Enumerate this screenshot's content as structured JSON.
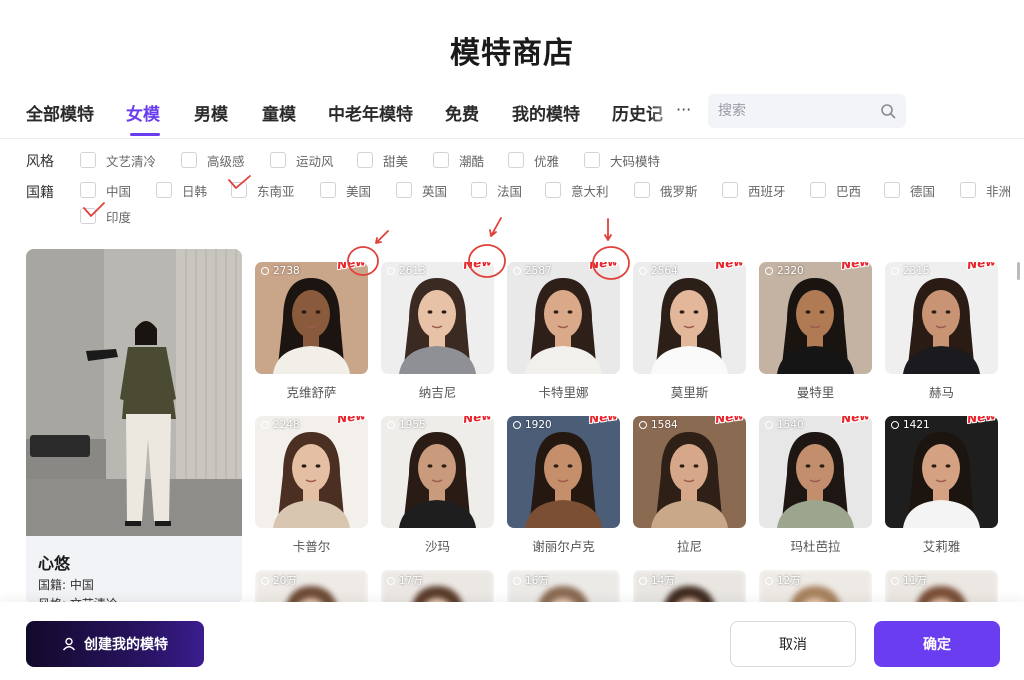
{
  "title": "模特商店",
  "tabs": [
    {
      "label": "全部模特"
    },
    {
      "label": "女模"
    },
    {
      "label": "男模"
    },
    {
      "label": "童模"
    },
    {
      "label": "中老年模特"
    },
    {
      "label": "免费"
    },
    {
      "label": "我的模特"
    },
    {
      "label": "历史记"
    }
  ],
  "more_label": "···",
  "search": {
    "placeholder": "搜索"
  },
  "filters": {
    "style": {
      "label": "风格",
      "options": [
        "文艺清冷",
        "高级感",
        "运动风",
        "甜美",
        "潮酷",
        "优雅",
        "大码模特"
      ]
    },
    "country": {
      "label": "国籍",
      "options": [
        "中国",
        "日韩",
        "东南亚",
        "美国",
        "英国",
        "法国",
        "意大利",
        "俄罗斯",
        "西班牙",
        "巴西",
        "德国",
        "非洲",
        "印度"
      ]
    }
  },
  "featured": {
    "name": "心悠",
    "country_line": "国籍: 中国",
    "style_line": "风格: 文艺清冷"
  },
  "new_badge": "New",
  "models": [
    {
      "name": "克维舒萨",
      "count": "2738",
      "new": true,
      "skin": "#8a5a3c",
      "hair": "#1c1410",
      "bg": "#c9a58a",
      "top": "#f2efe9"
    },
    {
      "name": "纳吉尼",
      "count": "2613",
      "new": true,
      "skin": "#e8c2a6",
      "hair": "#3b2a22",
      "bg": "#eeeeee",
      "top": "#8f9096"
    },
    {
      "name": "卡特里娜",
      "count": "2587",
      "new": true,
      "skin": "#d9a98a",
      "hair": "#2e2019",
      "bg": "#e9e9e9",
      "top": "#f1f0ed"
    },
    {
      "name": "莫里斯",
      "count": "2564",
      "new": true,
      "skin": "#e2b79a",
      "hair": "#2c1f18",
      "bg": "#ececec",
      "top": "#fafafa"
    },
    {
      "name": "曼特里",
      "count": "2320",
      "new": true,
      "skin": "#b07a55",
      "hair": "#1a1410",
      "bg": "#c4b3a3",
      "top": "#151515"
    },
    {
      "name": "赫马",
      "count": "2315",
      "new": true,
      "skin": "#c89474",
      "hair": "#2a1c15",
      "bg": "#efefef",
      "top": "#1b1b1f"
    },
    {
      "name": "卡普尔",
      "count": "2248",
      "new": true,
      "skin": "#e5bfa3",
      "hair": "#4a2f22",
      "bg": "#f3f0ec",
      "top": "#d9c6b0"
    },
    {
      "name": "沙玛",
      "count": "1955",
      "new": true,
      "skin": "#c99a7c",
      "hair": "#2a1c15",
      "bg": "#efede9",
      "top": "#1e1e1e"
    },
    {
      "name": "谢丽尔卢克",
      "count": "1920",
      "new": true,
      "skin": "#c58f6c",
      "hair": "#241811",
      "bg": "#4c5d78",
      "top": "#7a4f33"
    },
    {
      "name": "拉尼",
      "count": "1584",
      "new": true,
      "skin": "#d6a889",
      "hair": "#2e1f17",
      "bg": "#8b6a52",
      "top": "#c8a888"
    },
    {
      "name": "玛杜芭拉",
      "count": "1540",
      "new": true,
      "skin": "#c28e6e",
      "hair": "#1e1612",
      "bg": "#e7e7e7",
      "top": "#9ca58e"
    },
    {
      "name": "艾莉雅",
      "count": "1421",
      "new": true,
      "skin": "#d4a282",
      "hair": "#1c140f",
      "bg": "#1e1e1e",
      "top": "#f4f4f4"
    },
    {
      "name": "",
      "count": "20万",
      "new": false,
      "skin": "#e8c9b5",
      "hair": "#6d4a35",
      "bg": "#eeeae6",
      "top": "#dddddd"
    },
    {
      "name": "",
      "count": "17万",
      "new": false,
      "skin": "#ecd0bd",
      "hair": "#5a3b2a",
      "bg": "#ebe7e3",
      "top": "#dddddd"
    },
    {
      "name": "",
      "count": "16万",
      "new": false,
      "skin": "#e9cbb6",
      "hair": "#8a6a52",
      "bg": "#eceae7",
      "top": "#dddddd"
    },
    {
      "name": "",
      "count": "14万",
      "new": false,
      "skin": "#e8c7b0",
      "hair": "#3f2a1f",
      "bg": "#e9e6e2",
      "top": "#dddddd"
    },
    {
      "name": "",
      "count": "12万",
      "new": false,
      "skin": "#eacbb4",
      "hair": "#a8825f",
      "bg": "#ede9e4",
      "top": "#dddddd"
    },
    {
      "name": "",
      "count": "11万",
      "new": false,
      "skin": "#e6c4ad",
      "hair": "#7a4f37",
      "bg": "#ebe7e2",
      "top": "#dddddd"
    }
  ],
  "footer": {
    "create_label": "创建我的模特",
    "cancel_label": "取消",
    "confirm_label": "确定"
  },
  "colors": {
    "accent": "#6b3df0",
    "new_red": "#e8232b",
    "annotation_red": "#e0413a"
  },
  "icons": [
    "search-icon",
    "user-icon"
  ]
}
